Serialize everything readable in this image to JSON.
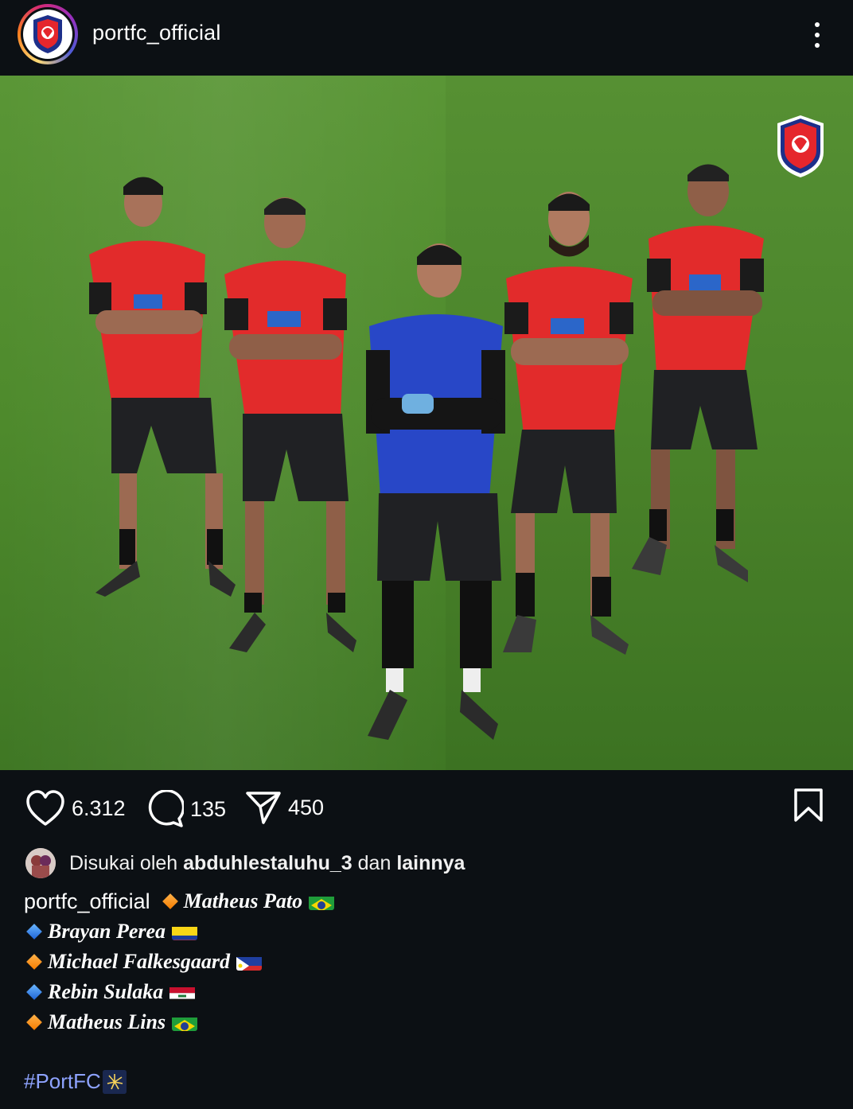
{
  "post": {
    "username": "portfc_official",
    "likes_count": "6.312",
    "comments_count": "135",
    "shares_count": "450"
  },
  "likes": {
    "prefix": "Disukai oleh",
    "user": "abduhlestaluhu_3",
    "joiner": "dan",
    "others": "lainnya"
  },
  "caption": {
    "username": "portfc_official",
    "players": [
      {
        "name": "Matheus Pato",
        "flag": "brazil",
        "marker": "orange-diamond"
      },
      {
        "name": "Brayan Perea",
        "flag": "colombia",
        "marker": "blue-diamond"
      },
      {
        "name": "Michael Falkesgaard",
        "flag": "philippines",
        "marker": "orange-diamond"
      },
      {
        "name": "Rebin Sulaka",
        "flag": "iraq",
        "marker": "blue-diamond"
      },
      {
        "name": "Matheus Lins",
        "flag": "brazil",
        "marker": "orange-diamond"
      }
    ],
    "hashtag": "#PortFC"
  },
  "colors": {
    "background": "#0c1014",
    "text": "#f5f5f5",
    "hashtag": "#8ea3ff",
    "grass": "#4f8a2e"
  },
  "icons": [
    "heart-icon",
    "comment-icon",
    "share-icon",
    "bookmark-icon",
    "more-options-icon"
  ]
}
